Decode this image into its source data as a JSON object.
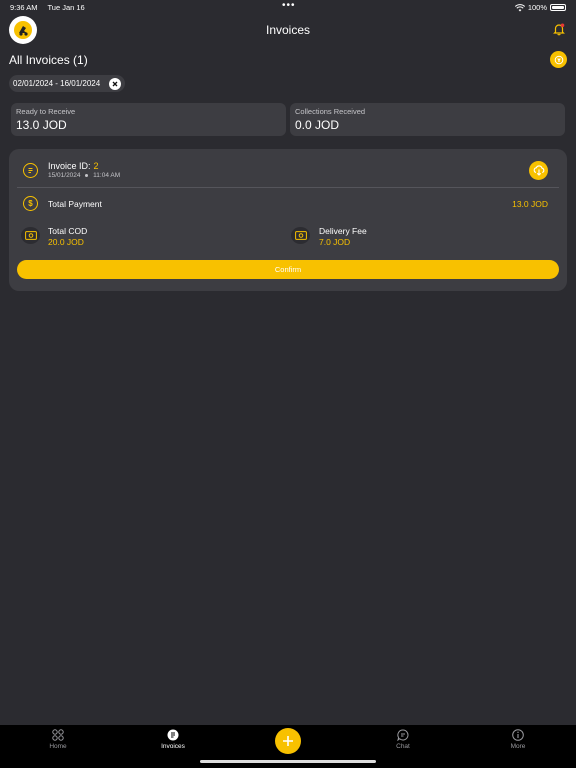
{
  "status_bar": {
    "time": "9:36 AM",
    "date": "Tue Jan 16",
    "battery": "100%"
  },
  "header": {
    "title": "Invoices"
  },
  "list": {
    "title": "All Invoices (1)"
  },
  "filter": {
    "date_range": "02/01/2024 - 16/01/2024"
  },
  "stats": [
    {
      "label": "Ready to Receive",
      "value": "13.0 JOD"
    },
    {
      "label": "Collections Received",
      "value": "0.0 JOD"
    }
  ],
  "invoice": {
    "id_label": "Invoice ID:",
    "id": "2",
    "date": "15/01/2024",
    "time": "11:04 AM",
    "total_payment_label": "Total Payment",
    "total_payment_value": "13.0 JOD",
    "total_cod_label": "Total COD",
    "total_cod_value": "20.0 JOD",
    "delivery_fee_label": "Delivery Fee",
    "delivery_fee_value": "7.0 JOD",
    "confirm_label": "Confirm"
  },
  "tabbar": {
    "items": [
      {
        "label": "Home",
        "icon": "grid-icon"
      },
      {
        "label": "Invoices",
        "icon": "invoice-icon"
      },
      {
        "label": "Chat",
        "icon": "chat-icon"
      },
      {
        "label": "More",
        "icon": "info-icon"
      }
    ],
    "active": "Invoices"
  },
  "colors": {
    "accent": "#f8c100",
    "background": "#2b2b30",
    "card": "#3d3d42",
    "tabbar": "#000000"
  }
}
